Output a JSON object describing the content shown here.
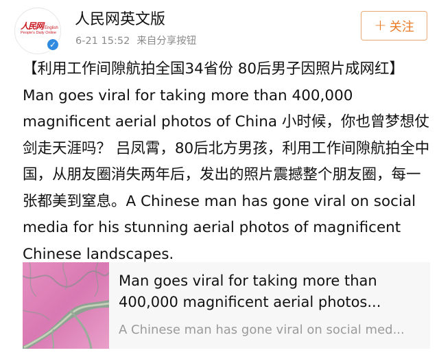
{
  "user": {
    "name": "人民网英文版",
    "timestamp": "6-21 15:52",
    "source": "来自分享按钮",
    "avatar_logo_cn": "人民网",
    "avatar_logo_en": "English",
    "avatar_logo_sub": "People's Daily Online",
    "verified_icon": "check-icon"
  },
  "follow_button": {
    "icon": "+",
    "label": "关注"
  },
  "post": {
    "text": "【利用工作间隙航拍全国34省份 80后男子因照片成网红】Man goes viral for taking more than 400,000 magnificent aerial photos of China 小时候，你也曾梦想仗剑走天涯吗？ 吕凤霄，80后北方男孩，利用工作间隙航拍全中国，从朋友圈消失两年后，发出的照片震撼整个朋友圈，每一张都美到窒息。A Chinese man has gone viral on social media for his stunning aerial photos of magnificent Chinese landscapes."
  },
  "link_card": {
    "title_line1": "Man goes viral for taking more than",
    "title_line2": "400,000 magnificent aerial photos...",
    "description": "A Chinese man has gone viral on social med...",
    "thumbnail": "aerial-landscape-thumbnail"
  },
  "colors": {
    "accent_orange": "#ea7b26",
    "follow_border": "#e9a871",
    "verified_blue": "#2e8bdf",
    "logo_red": "#c8161e",
    "meta_gray": "#8a8a8a",
    "card_bg": "#f7f7f7"
  }
}
